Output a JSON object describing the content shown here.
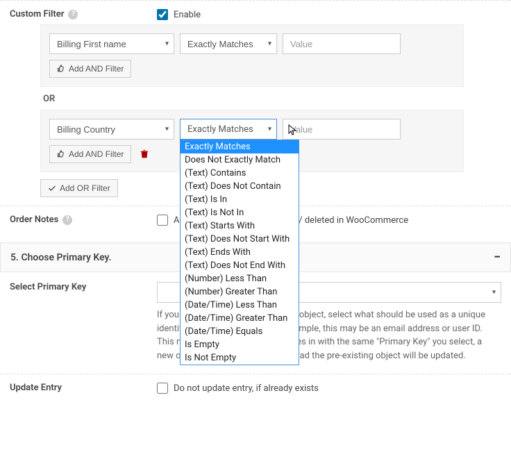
{
  "custom_filter": {
    "label": "Custom Filter",
    "enable_label": "Enable",
    "enabled": true,
    "or_label": "OR",
    "add_and_label": "Add AND Filter",
    "add_or_label": "Add OR Filter",
    "value_placeholder": "Value",
    "groups": [
      {
        "field": "Billing First name",
        "operator": "Exactly Matches",
        "value": ""
      },
      {
        "field": "Billing Country",
        "operator": "Exactly Matches",
        "value": ""
      }
    ],
    "operator_options": [
      "Exactly Matches",
      "Does Not Exactly Match",
      "(Text) Contains",
      "(Text) Does Not Contain",
      "(Text) Is In",
      "(Text) Is Not In",
      "(Text) Starts With",
      "(Text) Does Not Start With",
      "(Text) Ends With",
      "(Text) Does Not End With",
      "(Number) Less Than",
      "(Number) Greater Than",
      "(Date/Time) Less Than",
      "(Date/Time) Greater Than",
      "(Date/Time) Equals",
      "Is Empty",
      "Is Not Empty"
    ]
  },
  "order_notes": {
    "label": "Order Notes",
    "checkbox_label": "Add / Delete node when added / deleted in WooCommerce"
  },
  "primary_key_section": {
    "title": "5. Choose Primary Key.",
    "select_label": "Select Primary Key",
    "select_value": "",
    "help_text": "If you want to sync with an existing object, select what should be used as a unique identifier to find that object. For example, this may be an email address or user ID. This means when a new order comes in with the same \"Primary Key\" you select, a new object will not be created, instead the pre-existing object will be updated."
  },
  "update_entry": {
    "label": "Update Entry",
    "checkbox_label": "Do not update entry, if already exists"
  }
}
